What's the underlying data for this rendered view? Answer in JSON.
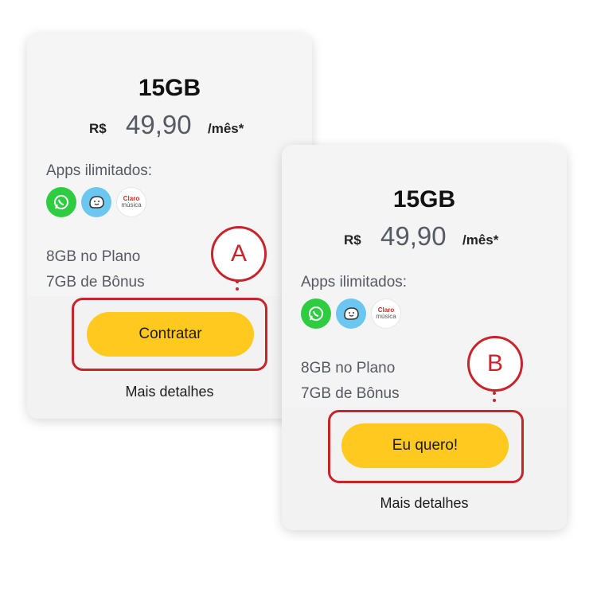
{
  "plans": [
    {
      "title": "15GB",
      "currency": "R$",
      "price": "49,90",
      "period": "/mês*",
      "apps_label": "Apps ilimitados:",
      "apps": [
        {
          "icon": "whatsapp-icon"
        },
        {
          "icon": "waze-icon"
        },
        {
          "icon": "claro-musica-icon",
          "text_line1": "Claro",
          "text_line2": "música"
        }
      ],
      "benefits": [
        "8GB no Plano",
        "7GB de Bônus"
      ],
      "cta_label": "Contratar",
      "details_label": "Mais detalhes"
    },
    {
      "title": "15GB",
      "currency": "R$",
      "price": "49,90",
      "period": "/mês*",
      "apps_label": "Apps ilimitados:",
      "apps": [
        {
          "icon": "whatsapp-icon"
        },
        {
          "icon": "waze-icon"
        },
        {
          "icon": "claro-musica-icon",
          "text_line1": "Claro",
          "text_line2": "música"
        }
      ],
      "benefits": [
        "8GB no Plano",
        "7GB de Bônus"
      ],
      "cta_label": "Eu quero!",
      "details_label": "Mais detalhes"
    }
  ],
  "annotations": {
    "a": "A",
    "b": "B",
    "color": "#c8242b"
  },
  "colors": {
    "cta": "#ffc91f",
    "whatsapp": "#2ecc40",
    "waze": "#6cc7f0"
  }
}
